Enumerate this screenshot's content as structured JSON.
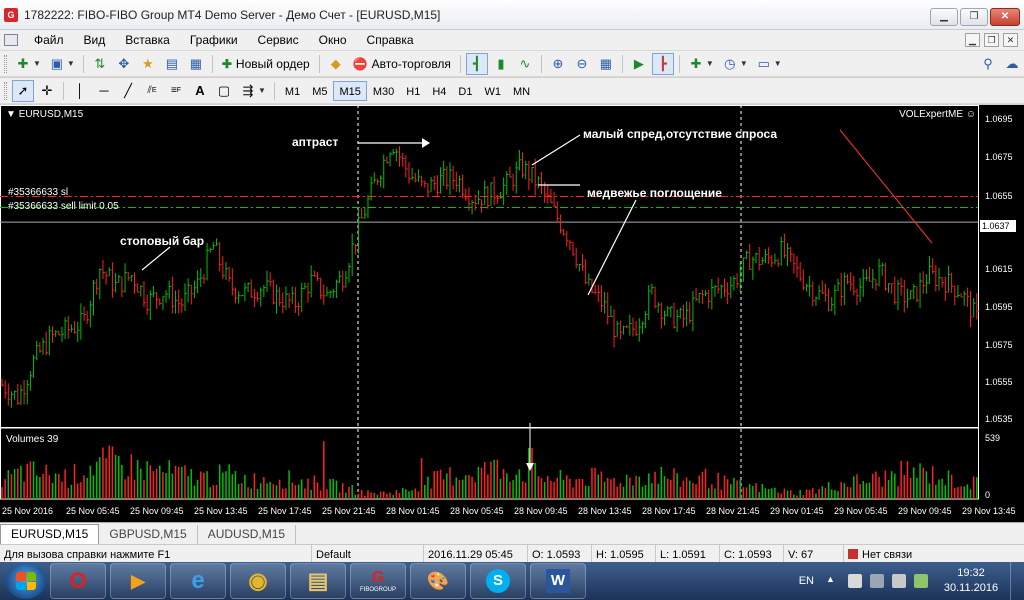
{
  "window": {
    "title": "1782222: FIBO-FIBO Group MT4 Demo Server - Демо Счет - [EURUSD,M15]",
    "app_icon": "G"
  },
  "menu": {
    "items": [
      "Файл",
      "Вид",
      "Вставка",
      "Графики",
      "Сервис",
      "Окно",
      "Справка"
    ]
  },
  "toolbar": {
    "new_order": "Новый ордер",
    "auto_trading": "Авто-торговля",
    "timeframes": [
      "M1",
      "M5",
      "M15",
      "M30",
      "H1",
      "H4",
      "D1",
      "W1",
      "MN"
    ],
    "active_timeframe": "M15",
    "line_tool_labels": [
      "E",
      "F",
      "A"
    ]
  },
  "chart": {
    "symbol_label": "EURUSD,M15",
    "expert_label": "VOLExpertME",
    "volumes_label": "Volumes 39",
    "volume_max_label": "539",
    "volume_min_label": "0",
    "order_labels": [
      "#35366633 sl",
      "#35366633 sell limit 0.05"
    ],
    "annotations": [
      "аптраст",
      "малый спред,отсутствие  спроса",
      "медвежье поглощение",
      "стоповый бар"
    ],
    "current_price": "1.0637",
    "colors": {
      "up": "#00c000",
      "down": "#ff2020",
      "background": "#000000",
      "sl_line": "#ff2020",
      "limit_line": "#00c000"
    }
  },
  "chart_data": {
    "type": "bar",
    "title": "EURUSD,M15",
    "price_ticks": [
      "1.0695",
      "1.0675",
      "1.0655",
      "1.0637",
      "1.0615",
      "1.0595",
      "1.0575",
      "1.0555",
      "1.0535"
    ],
    "ylim": [
      1.0525,
      1.0701
    ],
    "sl_level": 1.0651,
    "limit_level": 1.0645,
    "current_level": 1.0637,
    "time_labels": [
      "25 Nov 2016",
      "25 Nov 05:45",
      "25 Nov 09:45",
      "25 Nov 13:45",
      "25 Nov 17:45",
      "25 Nov 21:45",
      "28 Nov 01:45",
      "28 Nov 05:45",
      "28 Nov 09:45",
      "28 Nov 13:45",
      "28 Nov 17:45",
      "28 Nov 21:45",
      "29 Nov 01:45",
      "29 Nov 05:45",
      "29 Nov 09:45",
      "29 Nov 13:45"
    ],
    "close_path": [
      1.0548,
      1.0541,
      1.0562,
      1.0574,
      1.0578,
      1.0582,
      1.0612,
      1.0602,
      1.0608,
      1.0594,
      1.0599,
      1.0592,
      1.0602,
      1.0624,
      1.0602,
      1.0598,
      1.0602,
      1.0596,
      1.0592,
      1.0605,
      1.0597,
      1.0608,
      1.0635,
      1.066,
      1.0681,
      1.0664,
      1.0655,
      1.066,
      1.0661,
      1.065,
      1.0652,
      1.0657,
      1.0667,
      1.0658,
      1.0642,
      1.0627,
      1.0602,
      1.0592,
      1.0573,
      1.058,
      1.0598,
      1.0585,
      1.0584,
      1.0596,
      1.06,
      1.0604,
      1.0617,
      1.0616,
      1.0621,
      1.0609,
      1.0599,
      1.0594,
      1.0605,
      1.0601,
      1.061,
      1.0598,
      1.0595,
      1.0608,
      1.0605,
      1.0599,
      1.0584
    ],
    "volume_path": [
      0.3,
      0.45,
      0.4,
      0.35,
      0.55,
      0.6,
      0.5,
      0.45,
      0.4,
      0.35,
      0.4,
      0.3,
      0.35,
      0.3,
      0.25,
      0.2,
      0.1,
      0.1,
      0.15,
      0.3,
      0.4,
      0.45,
      0.5,
      0.45,
      0.35,
      0.3,
      0.35,
      0.3,
      0.35,
      0.4,
      0.3,
      0.35,
      0.25,
      0.2,
      0.15,
      0.1,
      0.15,
      0.25,
      0.3,
      0.35,
      0.45,
      0.4,
      0.3,
      0.25
    ],
    "volume_peaks": [
      0.85,
      0.55,
      0.75,
      0.6
    ]
  },
  "tabs": [
    "EURUSD,M15",
    "GBPUSD,M15",
    "AUDUSD,M15"
  ],
  "status": {
    "help": "Для вызова справки нажмите F1",
    "profile": "Default",
    "datetime": "2016.11.29 05:45",
    "open": "O: 1.0593",
    "high": "H: 1.0595",
    "low": "L: 1.0591",
    "close": "C: 1.0593",
    "volume": "V: 67",
    "connection": "Нет связи"
  },
  "taskbar": {
    "apps": [
      "opera",
      "media-player",
      "internet-explorer",
      "chrome",
      "file-explorer",
      "fibo-group",
      "paint",
      "skype",
      "word"
    ],
    "app_glyphs": [
      "O",
      "▶",
      "e",
      "◉",
      "▤",
      "FIBOGROUP",
      "🎨",
      "S",
      "W"
    ],
    "lang": "EN",
    "time": "19:32",
    "date": "30.11.2016"
  }
}
